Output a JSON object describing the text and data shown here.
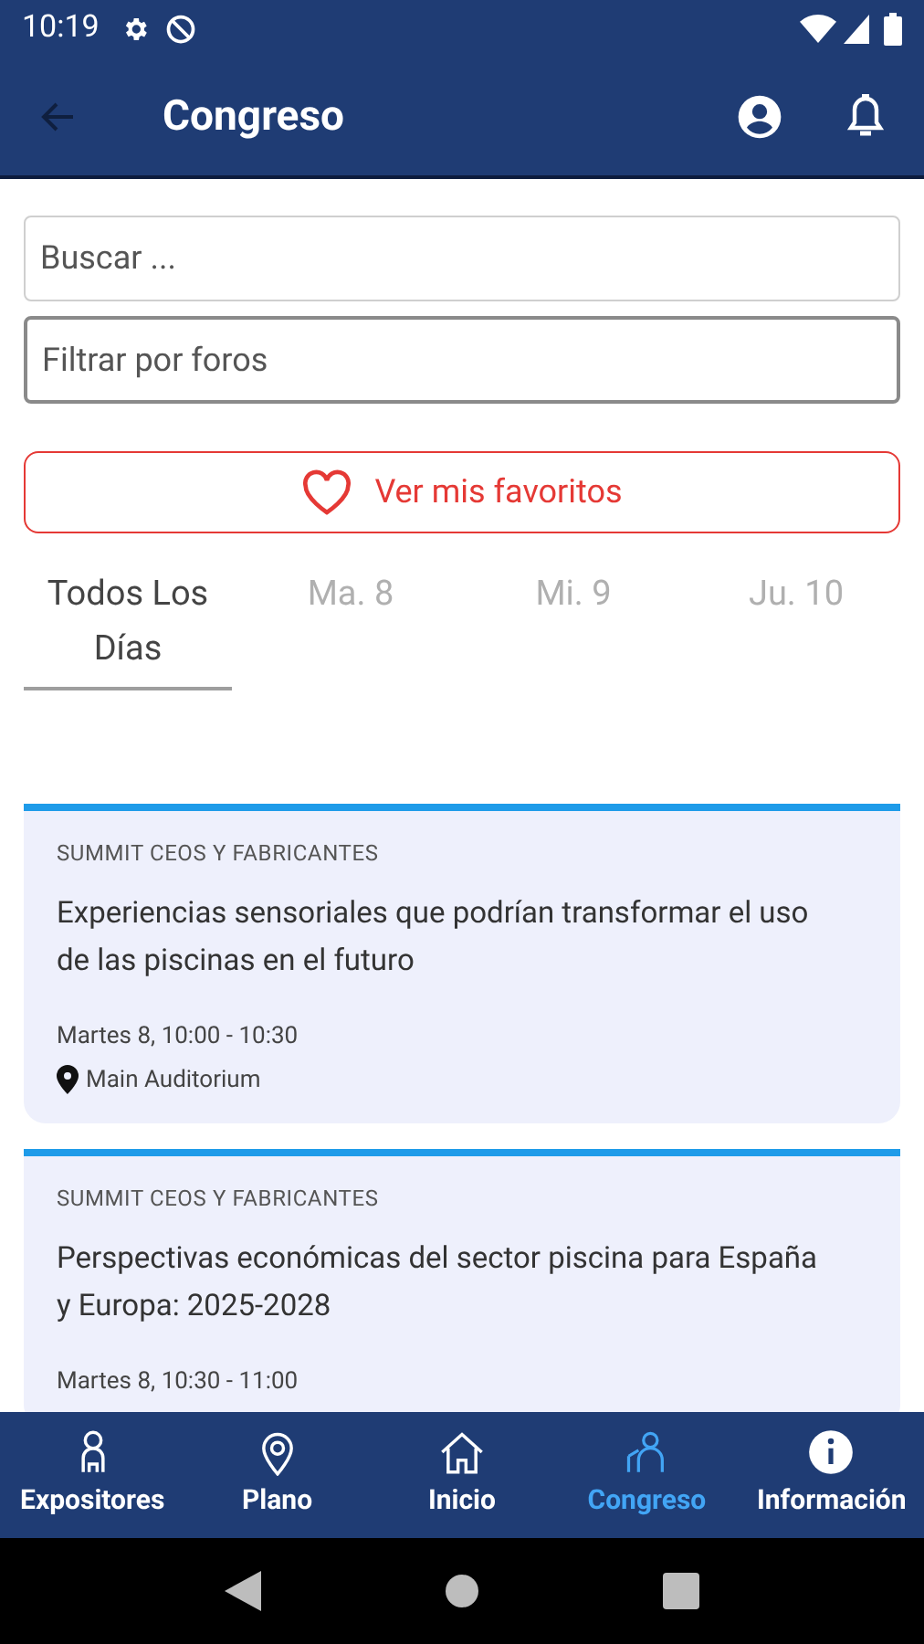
{
  "status_bar": {
    "time": "10:19"
  },
  "app_bar": {
    "title": "Congreso"
  },
  "search": {
    "placeholder": "Buscar ..."
  },
  "filter": {
    "placeholder": "Filtrar por foros"
  },
  "favorites_button": {
    "label": "Ver mis favoritos"
  },
  "day_tabs": [
    {
      "label": "Todos Los Días",
      "selected": true
    },
    {
      "label": "Ma. 8",
      "selected": false
    },
    {
      "label": "Mi. 9",
      "selected": false
    },
    {
      "label": "Ju. 10",
      "selected": false
    }
  ],
  "sessions": [
    {
      "category": "SUMMIT CEOS Y FABRICANTES",
      "title": "Experiencias sensoriales que podrían transformar el uso de las piscinas en el futuro",
      "time": "Martes 8, 10:00 - 10:30",
      "location": "Main Auditorium"
    },
    {
      "category": "SUMMIT CEOS Y FABRICANTES",
      "title": "Perspectivas económicas del sector piscina para España y Europa: 2025-2028",
      "time": "Martes 8, 10:30 - 11:00"
    }
  ],
  "bottom_nav": [
    {
      "label": "Expositores",
      "kind": "person",
      "selected": false
    },
    {
      "label": "Plano",
      "kind": "pin",
      "selected": false
    },
    {
      "label": "Inicio",
      "kind": "home",
      "selected": false
    },
    {
      "label": "Congreso",
      "kind": "speaker",
      "selected": true
    },
    {
      "label": "Información",
      "kind": "info",
      "selected": false
    }
  ]
}
